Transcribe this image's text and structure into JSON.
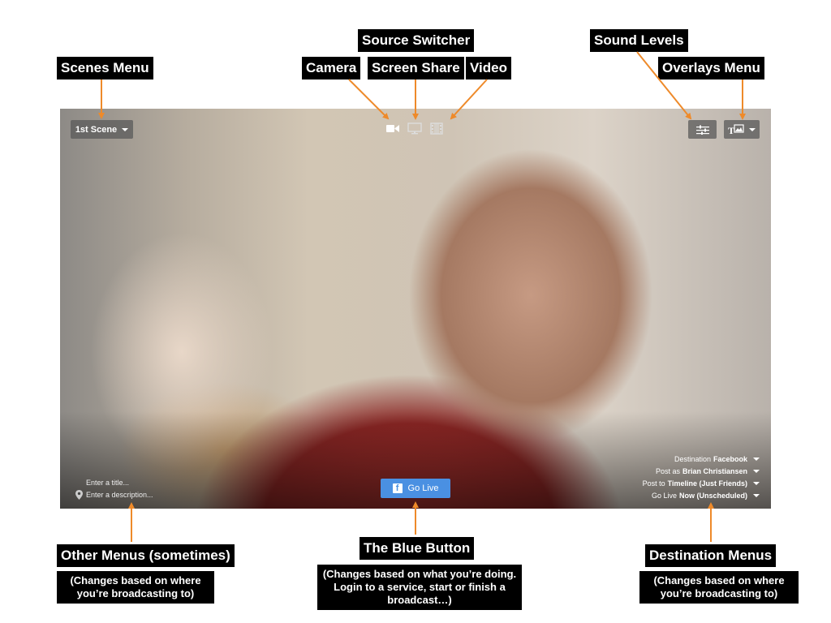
{
  "annotations": {
    "source_switcher": "Source Switcher",
    "sound_levels": "Sound Levels",
    "scenes_menu": "Scenes Menu",
    "camera": "Camera",
    "screen_share": "Screen Share",
    "video": "Video",
    "overlays_menu": "Overlays Menu",
    "other_menus": "Other Menus (sometimes)",
    "other_menus_note": "(Changes based on where you’re broadcasting to)",
    "blue_button": "The Blue Button",
    "blue_button_note": "(Changes based on what you’re doing. Login to a service, start or finish a broadcast…)",
    "destination_menus": "Destination Menus",
    "destination_menus_note": "(Changes based on where you’re broadcasting to)"
  },
  "app": {
    "scene_selector": "1st Scene",
    "title_placeholder": "Enter a title...",
    "description_placeholder": "Enter a description...",
    "go_live_label": "Go Live",
    "go_live_color": "#4a90e2",
    "icons": {
      "camera": "video-camera-icon",
      "screen": "monitor-icon",
      "video": "film-icon",
      "sound": "sliders-icon",
      "overlays": "text-image-icon",
      "location": "location-pin-icon",
      "facebook": "facebook-icon"
    },
    "destination": {
      "destination_prefix": "Destination",
      "destination_value": "Facebook",
      "post_as_prefix": "Post as",
      "post_as_value": "Brian Christiansen",
      "post_to_prefix": "Post to",
      "post_to_value": "Timeline (Just Friends)",
      "go_live_prefix": "Go Live",
      "go_live_value": "Now (Unscheduled)"
    }
  }
}
